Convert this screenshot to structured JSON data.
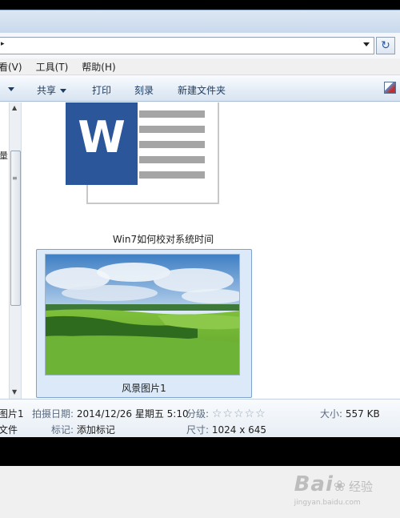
{
  "address": {
    "arrow": "▸"
  },
  "refresh_icon": "↻",
  "menu": [
    {
      "label": "看(V)"
    },
    {
      "label": "工具(T)"
    },
    {
      "label": "帮助(H)"
    }
  ],
  "toolbar": {
    "share": "共享",
    "burn": "打印",
    "record": "刻录",
    "new_folder": "新建文件夹"
  },
  "nav": {
    "glyph": "量"
  },
  "files": [
    {
      "name": "Win7如何校对系统时间",
      "icon": "word-icon",
      "icon_text": "W"
    },
    {
      "name": "风景图片1",
      "icon": "image-thumbnail"
    }
  ],
  "details": {
    "name": "图片1",
    "type": "文件",
    "date_key": "拍摄日期:",
    "date_val": "2014/12/26 星期五 5:10",
    "rating_key": "分级:",
    "rating_stars": "☆☆☆☆☆",
    "rating_value": 0,
    "size_key": "大小:",
    "size_val": "557 KB",
    "tags_key": "标记:",
    "tags_val": "添加标记",
    "dim_key": "尺寸:",
    "dim_val": "1024 x 645"
  },
  "watermark": {
    "logo": "Bai",
    "paw": "❀",
    "jy": "经验",
    "url": "jingyan.baidu.com"
  },
  "colors": {
    "word_blue": "#2b579a",
    "selection": "#dce9f8",
    "toolbar_text": "#1e3d66"
  }
}
